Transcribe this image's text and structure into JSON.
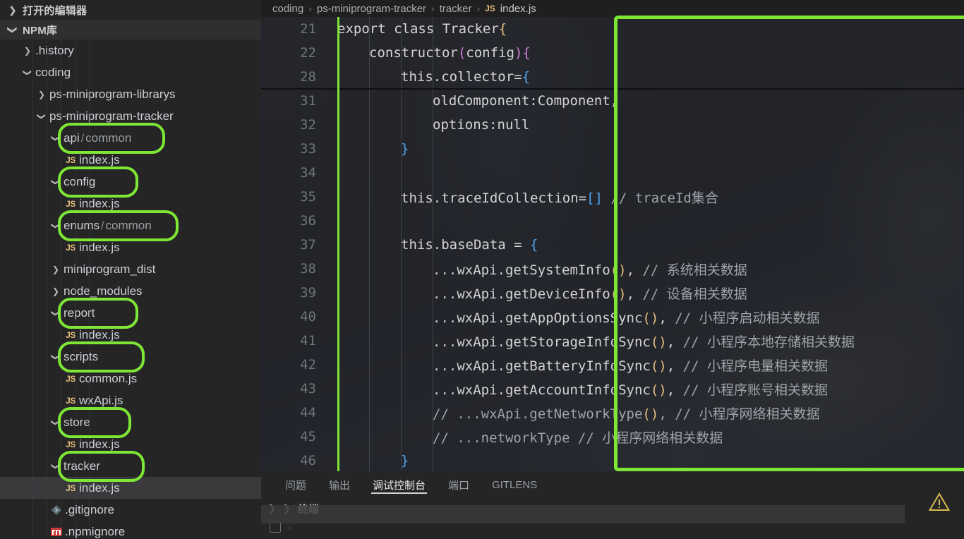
{
  "sidebar": {
    "sections": [
      {
        "label": "打开的编辑器",
        "icon": "chevron-right-icon",
        "expanded": false,
        "shaded": false
      },
      {
        "label": "NPM库",
        "icon": "chevron-down-icon",
        "expanded": true,
        "shaded": true
      }
    ],
    "tree": [
      {
        "label": ".history",
        "depth": 1,
        "kind": "folder",
        "arrow": "chevron-right-icon",
        "highlight": false,
        "selected": false
      },
      {
        "label": "coding",
        "depth": 1,
        "kind": "folder",
        "arrow": "chevron-down-icon",
        "highlight": false,
        "selected": false
      },
      {
        "label": "ps-miniprogram-librarys",
        "depth": 2,
        "kind": "folder",
        "arrow": "chevron-right-icon",
        "highlight": false,
        "selected": false
      },
      {
        "label": "ps-miniprogram-tracker",
        "depth": 2,
        "kind": "folder",
        "arrow": "chevron-down-icon",
        "highlight": false,
        "selected": false
      },
      {
        "label": "api",
        "sublabel": "common",
        "depth": 3,
        "kind": "folder",
        "arrow": "chevron-down-icon",
        "highlight": true,
        "selected": false
      },
      {
        "label": "index.js",
        "depth": 4,
        "kind": "js",
        "arrow": "none",
        "highlight": false,
        "selected": false
      },
      {
        "label": "config",
        "depth": 3,
        "kind": "folder",
        "arrow": "chevron-down-icon",
        "highlight": true,
        "selected": false
      },
      {
        "label": "index.js",
        "depth": 4,
        "kind": "js",
        "arrow": "none",
        "highlight": false,
        "selected": false
      },
      {
        "label": "enums",
        "sublabel": "common",
        "depth": 3,
        "kind": "folder",
        "arrow": "chevron-down-icon",
        "highlight": true,
        "selected": false
      },
      {
        "label": "index.js",
        "depth": 4,
        "kind": "js",
        "arrow": "none",
        "highlight": false,
        "selected": false
      },
      {
        "label": "miniprogram_dist",
        "depth": 3,
        "kind": "folder",
        "arrow": "chevron-right-icon",
        "highlight": false,
        "selected": false
      },
      {
        "label": "node_modules",
        "depth": 3,
        "kind": "folder",
        "arrow": "chevron-right-icon",
        "highlight": false,
        "selected": false
      },
      {
        "label": "report",
        "depth": 3,
        "kind": "folder",
        "arrow": "chevron-down-icon",
        "highlight": true,
        "selected": false
      },
      {
        "label": "index.js",
        "depth": 4,
        "kind": "js",
        "arrow": "none",
        "highlight": false,
        "selected": false
      },
      {
        "label": "scripts",
        "depth": 3,
        "kind": "folder",
        "arrow": "chevron-down-icon",
        "highlight": true,
        "selected": false
      },
      {
        "label": "common.js",
        "depth": 4,
        "kind": "js",
        "arrow": "none",
        "highlight": false,
        "selected": false
      },
      {
        "label": "wxApi.js",
        "depth": 4,
        "kind": "js",
        "arrow": "none",
        "highlight": false,
        "selected": false
      },
      {
        "label": "store",
        "depth": 3,
        "kind": "folder",
        "arrow": "chevron-down-icon",
        "highlight": true,
        "selected": false
      },
      {
        "label": "index.js",
        "depth": 4,
        "kind": "js",
        "arrow": "none",
        "highlight": false,
        "selected": false
      },
      {
        "label": "tracker",
        "depth": 3,
        "kind": "folder",
        "arrow": "chevron-down-icon",
        "highlight": true,
        "selected": false
      },
      {
        "label": "index.js",
        "depth": 4,
        "kind": "js",
        "arrow": "none",
        "highlight": false,
        "selected": true
      },
      {
        "label": ".gitignore",
        "depth": 3,
        "kind": "git",
        "arrow": "none",
        "highlight": false,
        "selected": false
      },
      {
        "label": ".npmignore",
        "depth": 3,
        "kind": "npm",
        "arrow": "none",
        "highlight": false,
        "selected": false
      }
    ]
  },
  "breadcrumb": {
    "items": [
      "coding",
      "ps-miniprogram-tracker",
      "tracker"
    ],
    "separator": "›",
    "file": "index.js",
    "file_badge": "JS"
  },
  "editor": {
    "lines": [
      {
        "num": "21",
        "indent": 0,
        "fold_below": false,
        "tokens": [
          {
            "t": "export class Tracker",
            "c": "w"
          },
          {
            "t": "{",
            "c": "y"
          }
        ]
      },
      {
        "num": "22",
        "indent": 1,
        "fold_below": false,
        "tokens": [
          {
            "t": "constructor",
            "c": "w"
          },
          {
            "t": "(",
            "c": "p"
          },
          {
            "t": "config",
            "c": "w"
          },
          {
            "t": ")",
            "c": "p"
          },
          {
            "t": "{",
            "c": "p"
          }
        ]
      },
      {
        "num": "28",
        "indent": 2,
        "fold_below": true,
        "tokens": [
          {
            "t": "this.collector=",
            "c": "w"
          },
          {
            "t": "{",
            "c": "b"
          }
        ]
      },
      {
        "num": "31",
        "indent": 3,
        "fold_below": false,
        "tokens": [
          {
            "t": "oldComponent:Component,",
            "c": "w"
          }
        ]
      },
      {
        "num": "32",
        "indent": 3,
        "fold_below": false,
        "tokens": [
          {
            "t": "options:null",
            "c": "w"
          }
        ]
      },
      {
        "num": "33",
        "indent": 2,
        "fold_below": false,
        "tokens": [
          {
            "t": "}",
            "c": "b"
          }
        ]
      },
      {
        "num": "34",
        "indent": 0,
        "fold_below": false,
        "tokens": []
      },
      {
        "num": "35",
        "indent": 2,
        "fold_below": false,
        "tokens": [
          {
            "t": "this.traceIdCollection=",
            "c": "w"
          },
          {
            "t": "[]",
            "c": "b"
          },
          {
            "t": " ",
            "c": "w"
          },
          {
            "t": "// traceId集合",
            "c": "c"
          }
        ]
      },
      {
        "num": "36",
        "indent": 0,
        "fold_below": false,
        "tokens": []
      },
      {
        "num": "37",
        "indent": 2,
        "fold_below": false,
        "tokens": [
          {
            "t": "this.baseData = ",
            "c": "w"
          },
          {
            "t": "{",
            "c": "b"
          }
        ]
      },
      {
        "num": "38",
        "indent": 3,
        "fold_below": false,
        "tokens": [
          {
            "t": "...wxApi.getSystemInfo",
            "c": "w"
          },
          {
            "t": "()",
            "c": "y"
          },
          {
            "t": ", ",
            "c": "w"
          },
          {
            "t": "// 系统相关数据",
            "c": "c"
          }
        ]
      },
      {
        "num": "39",
        "indent": 3,
        "fold_below": false,
        "tokens": [
          {
            "t": "...wxApi.getDeviceInfo",
            "c": "w"
          },
          {
            "t": "()",
            "c": "y"
          },
          {
            "t": ", ",
            "c": "w"
          },
          {
            "t": "// 设备相关数据",
            "c": "c"
          }
        ]
      },
      {
        "num": "40",
        "indent": 3,
        "fold_below": false,
        "tokens": [
          {
            "t": "...wxApi.getAppOptionsSync",
            "c": "w"
          },
          {
            "t": "()",
            "c": "y"
          },
          {
            "t": ", ",
            "c": "w"
          },
          {
            "t": "// 小程序启动相关数据",
            "c": "c"
          }
        ]
      },
      {
        "num": "41",
        "indent": 3,
        "fold_below": false,
        "tokens": [
          {
            "t": "...wxApi.getStorageInfoSync",
            "c": "w"
          },
          {
            "t": "()",
            "c": "y"
          },
          {
            "t": ", ",
            "c": "w"
          },
          {
            "t": "// 小程序本地存储相关数据",
            "c": "c"
          }
        ]
      },
      {
        "num": "42",
        "indent": 3,
        "fold_below": false,
        "tokens": [
          {
            "t": "...wxApi.getBatteryInfoSync",
            "c": "w"
          },
          {
            "t": "()",
            "c": "y"
          },
          {
            "t": ", ",
            "c": "w"
          },
          {
            "t": "// 小程序电量相关数据",
            "c": "c"
          }
        ]
      },
      {
        "num": "43",
        "indent": 3,
        "fold_below": false,
        "tokens": [
          {
            "t": "...wxApi.getAccountInfoSync",
            "c": "w"
          },
          {
            "t": "()",
            "c": "y"
          },
          {
            "t": ", ",
            "c": "w"
          },
          {
            "t": "// 小程序账号相关数据",
            "c": "c"
          }
        ]
      },
      {
        "num": "44",
        "indent": 3,
        "fold_below": false,
        "tokens": [
          {
            "t": "// ...wxApi.getNetworkType",
            "c": "c"
          },
          {
            "t": "()",
            "c": "y"
          },
          {
            "t": ", ",
            "c": "c"
          },
          {
            "t": "// 小程序网络相关数据",
            "c": "c"
          }
        ]
      },
      {
        "num": "45",
        "indent": 3,
        "fold_below": false,
        "tokens": [
          {
            "t": "// ...networkType // 小程序网络相关数据",
            "c": "c"
          }
        ]
      },
      {
        "num": "46",
        "indent": 2,
        "fold_below": false,
        "tokens": [
          {
            "t": "}",
            "c": "b"
          }
        ]
      }
    ]
  },
  "panel": {
    "tabs": [
      {
        "label": "问题",
        "active": false
      },
      {
        "label": "输出",
        "active": false
      },
      {
        "label": "调试控制台",
        "active": true
      },
      {
        "label": "端口",
        "active": false
      },
      {
        "label": "GITLENS",
        "active": false
      }
    ],
    "terminal_label": "终端",
    "terminal_expand_icon": "chevron-right-icon",
    "terminal_collapse_icon": "chevron-down-icon",
    "warning_icon": "warning-triangle-icon"
  },
  "colors": {
    "marker_green": "#7ee635",
    "sidebar_bg": "#252526",
    "editor_bg": "#1e1e1e",
    "js_badge": "#e5c07b",
    "bracket_blue": "#4fa6f0",
    "bracket_magenta": "#d67bd6",
    "comment_gray": "#9fa4a9",
    "warning_yellow": "#d7b94e"
  }
}
